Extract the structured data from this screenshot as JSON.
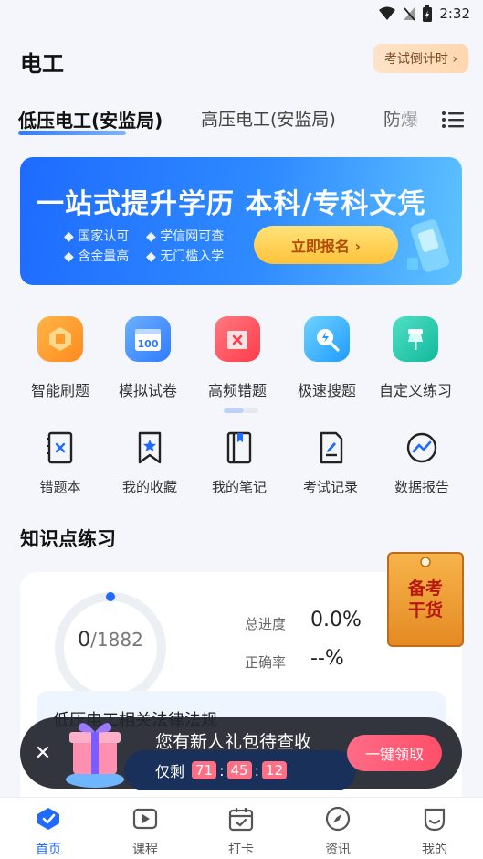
{
  "status_bar": {
    "time": "2:32",
    "icons": [
      "wifi-icon",
      "signal-off-icon",
      "battery-charging-icon"
    ]
  },
  "header": {
    "title": "电工",
    "countdown_label": "考试倒计时 ›"
  },
  "tabs": [
    {
      "label": "低压电工(安监局)",
      "active": true
    },
    {
      "label": "高压电工(安监局)",
      "active": false
    },
    {
      "label": "防爆",
      "active": false
    }
  ],
  "banner": {
    "title": "一站式提升学历 本科/专科文凭",
    "features": [
      "◆ 国家认可",
      "◆ 学信网可查",
      "◆ 含金量高",
      "◆ 无门槛入学"
    ],
    "cta": "立即报名 ›"
  },
  "features": [
    {
      "label": "智能刷题",
      "icon": "smart-practice-icon",
      "color": "#ff9a2b"
    },
    {
      "label": "模拟试卷",
      "icon": "mock-paper-icon",
      "color": "#3a8bff"
    },
    {
      "label": "高频错题",
      "icon": "frequent-errors-icon",
      "color": "#ff4d5a"
    },
    {
      "label": "极速搜题",
      "icon": "quick-search-icon",
      "color": "#2fb4ff"
    },
    {
      "label": "自定义练习",
      "icon": "custom-practice-icon",
      "color": "#1fc7b0"
    }
  ],
  "tools": [
    {
      "label": "错题本",
      "icon": "error-book-icon"
    },
    {
      "label": "我的收藏",
      "icon": "bookmark-icon"
    },
    {
      "label": "我的笔记",
      "icon": "notebook-icon"
    },
    {
      "label": "考试记录",
      "icon": "exam-record-icon"
    },
    {
      "label": "数据报告",
      "icon": "data-report-icon"
    }
  ],
  "knowledge": {
    "section_title": "知识点练习",
    "done": "0",
    "total": "/1882",
    "progress_fraction": 0,
    "progress_label": "总进度",
    "progress_value": "0.0%",
    "accuracy_label": "正确率",
    "accuracy_value": "--%",
    "chapter": "低压电工相关法律法规"
  },
  "promo_tag": {
    "line1": "备考",
    "line2": "干货"
  },
  "popup": {
    "title": "您有新人礼包待查收",
    "remaining_label": "仅剩",
    "hours": "71",
    "minutes": "45",
    "seconds": "12",
    "button": "一键领取"
  },
  "bottom_nav": [
    {
      "label": "首页",
      "icon": "home-icon",
      "active": true
    },
    {
      "label": "课程",
      "icon": "course-icon",
      "active": false
    },
    {
      "label": "打卡",
      "icon": "checkin-icon",
      "active": false
    },
    {
      "label": "资讯",
      "icon": "news-compass-icon",
      "active": false
    },
    {
      "label": "我的",
      "icon": "profile-icon",
      "active": false
    }
  ],
  "colors": {
    "accent": "#1f6bff",
    "popup_button": "#ff4f6a",
    "timer_box": "#ff6f86"
  }
}
